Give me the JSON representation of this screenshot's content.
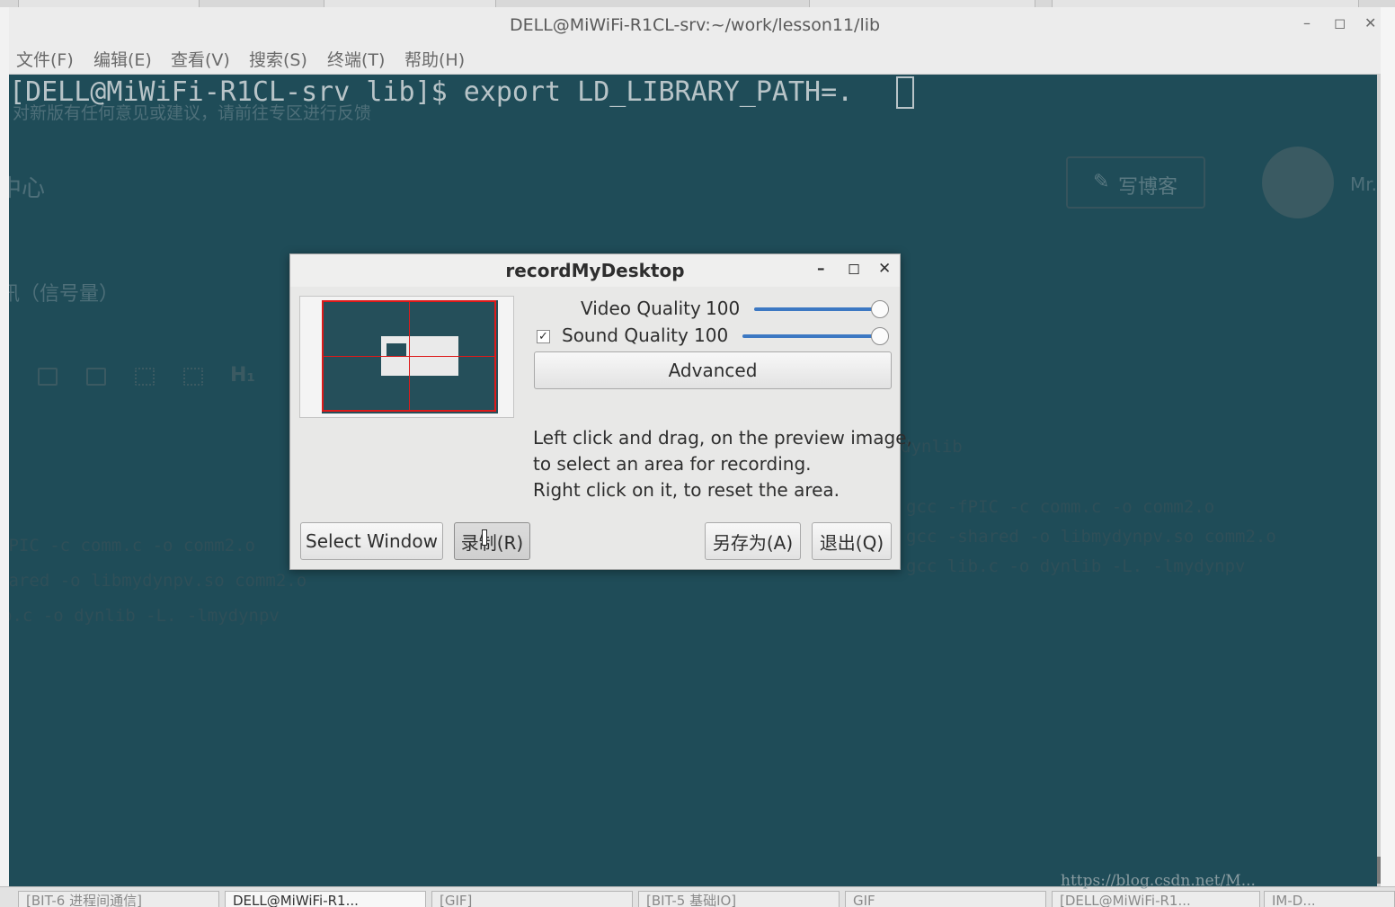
{
  "terminal": {
    "title": "DELL@MiWiFi-R1CL-srv:~/work/lesson11/lib",
    "window_controls": {
      "minimize": "–",
      "maximize": "◻",
      "close": "✕"
    },
    "menu": [
      "文件(F)",
      "编辑(E)",
      "查看(V)",
      "搜索(S)",
      "终端(T)",
      "帮助(H)"
    ],
    "command_line": "[DELL@MiWiFi-R1CL-srv lib]$ export LD_LIBRARY_PATH=."
  },
  "background_page": {
    "notice": "对新版有任何意见或建议，请前往专区进行反馈",
    "center": "中心",
    "write_blog": "写博客",
    "user_short": "Mr...",
    "signal_heading": "讯（信号量）",
    "heading_icon": "H₁",
    "dynlib": "dynlib",
    "code_right": [
      "gcc -fPIC -c comm.c -o comm2.o",
      "gcc -shared -o libmydynpv.so comm2.o",
      "gcc lib.c -o dynlib -L. -lmydynpv"
    ],
    "code_left": [
      "fPIC -c comm.c -o comm2.o",
      "hared -o libmydynpv.so comm2.o",
      "b.c -o dynlib -L. -lmydynpv"
    ]
  },
  "dialog": {
    "title": "recordMyDesktop",
    "window_controls": {
      "minimize": "–",
      "maximize": "◻",
      "close": "✕"
    },
    "video_quality": {
      "label": "Video Quality",
      "value": "100",
      "fraction": 1.0
    },
    "sound_quality": {
      "label": "Sound Quality",
      "value": "100",
      "fraction": 1.0,
      "checked": true,
      "check_mark": "✓"
    },
    "advanced_label": "Advanced",
    "help_lines": [
      "Left click and drag, on the preview image,",
      "to select an area for recording.",
      "Right click on it, to reset the area."
    ],
    "buttons": {
      "select_window": "Select Window",
      "record": "录制(R)",
      "save_as": "另存为(A)",
      "quit": "退出(Q)"
    }
  },
  "taskbar": {
    "items": [
      "[BIT-6 进程间通信]",
      "DELL@MiWiFi-R1...",
      "[GIF]",
      "[BIT-5 基础IO]",
      "GIF",
      "[DELL@MiWiFi-R1...",
      "IM-D..."
    ]
  },
  "watermark": "https://blog.csdn.net/M...",
  "colors": {
    "terminal_bg": "#1f4c58",
    "slider_accent": "#3c78c3",
    "selection_red": "#dd1a1a"
  }
}
